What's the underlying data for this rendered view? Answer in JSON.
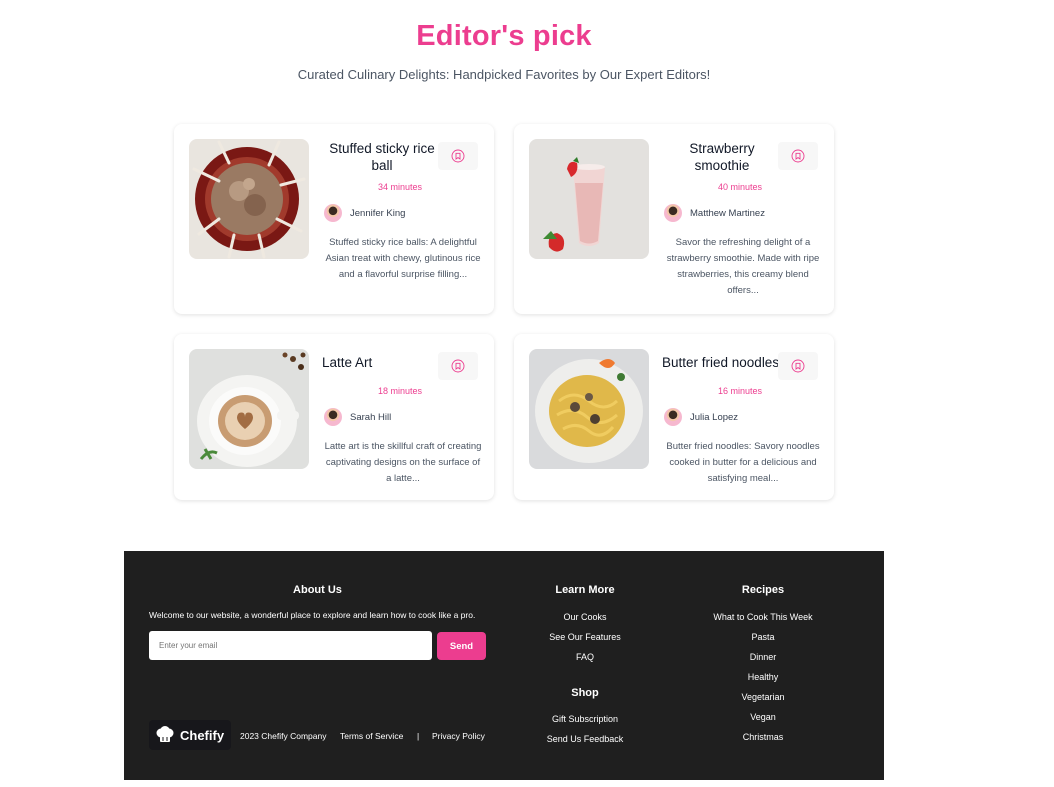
{
  "header": {
    "title": "Editor's pick",
    "subtitle": "Curated Culinary Delights: Handpicked Favorites by Our Expert Editors!"
  },
  "recipes": [
    {
      "title": "Stuffed sticky rice ball",
      "time": "34 minutes",
      "author": "Jennifer King",
      "description": "Stuffed sticky rice balls: A delightful Asian treat with chewy, glutinous rice and a flavorful surprise filling..."
    },
    {
      "title": "Strawberry smoothie",
      "time": "40 minutes",
      "author": "Matthew Martinez",
      "description": "Savor the refreshing delight of a strawberry smoothie. Made with ripe strawberries, this creamy blend offers..."
    },
    {
      "title": "Latte Art",
      "time": "18 minutes",
      "author": "Sarah Hill",
      "description": "Latte art is the skillful craft of creating captivating designs on the surface of a latte..."
    },
    {
      "title": "Butter fried noodles",
      "time": "16 minutes",
      "author": "Julia Lopez",
      "description": "Butter fried noodles: Savory noodles cooked in butter for a delicious and satisfying meal..."
    }
  ],
  "footer": {
    "about": {
      "heading": "About Us",
      "text": "Welcome to our website, a wonderful place to explore and learn how to cook like a pro.",
      "email_placeholder": "Enter your email",
      "send_label": "Send"
    },
    "learn_more": {
      "heading": "Learn More",
      "links": [
        "Our Cooks",
        "See Our Features",
        "FAQ"
      ]
    },
    "shop": {
      "heading": "Shop",
      "links": [
        "Gift Subscription",
        "Send Us Feedback"
      ]
    },
    "recipes": {
      "heading": "Recipes",
      "links": [
        "What to Cook This Week",
        "Pasta",
        "Dinner",
        "Healthy",
        "Vegetarian",
        "Vegan",
        "Christmas"
      ]
    },
    "brand": "Chefify",
    "copyright": "2023 Chefify Company",
    "terms": "Terms of Service",
    "separator": "|",
    "privacy": "Privacy Policy"
  },
  "colors": {
    "accent": "#ec3d8f",
    "footer_bg": "#1f1f1f"
  }
}
